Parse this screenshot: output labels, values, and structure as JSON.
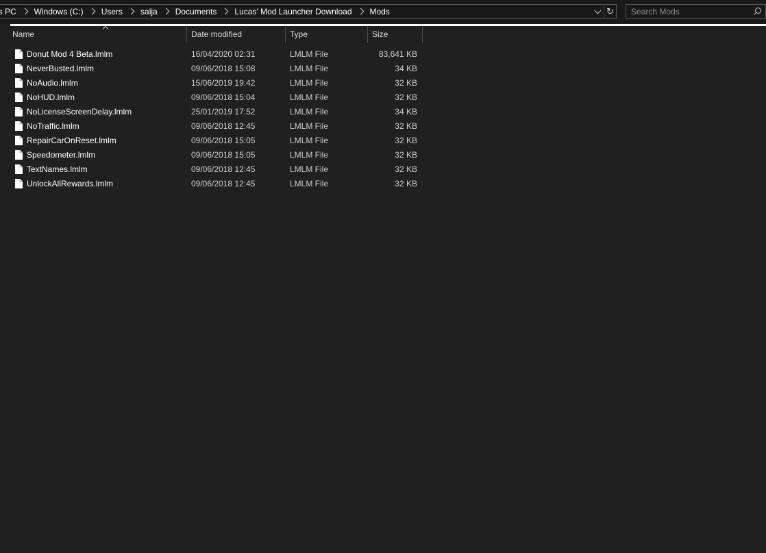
{
  "address": {
    "crumbs": [
      "is PC",
      "Windows (C:)",
      "Users",
      "salja",
      "Documents",
      "Lucas' Mod Launcher Download",
      "Mods"
    ]
  },
  "search": {
    "placeholder": "Search Mods"
  },
  "columns": {
    "name": "Name",
    "date": "Date modified",
    "type": "Type",
    "size": "Size"
  },
  "files": [
    {
      "name": "Donut Mod 4 Beta.lmlm",
      "date": "16/04/2020 02:31",
      "type": "LMLM File",
      "size": "83,641 KB"
    },
    {
      "name": "NeverBusted.lmlm",
      "date": "09/06/2018 15:08",
      "type": "LMLM File",
      "size": "34 KB"
    },
    {
      "name": "NoAudio.lmlm",
      "date": "15/06/2019 19:42",
      "type": "LMLM File",
      "size": "32 KB"
    },
    {
      "name": "NoHUD.lmlm",
      "date": "09/06/2018 15:04",
      "type": "LMLM File",
      "size": "32 KB"
    },
    {
      "name": "NoLicenseScreenDelay.lmlm",
      "date": "25/01/2019 17:52",
      "type": "LMLM File",
      "size": "34 KB"
    },
    {
      "name": "NoTraffic.lmlm",
      "date": "09/06/2018 12:45",
      "type": "LMLM File",
      "size": "32 KB"
    },
    {
      "name": "RepairCarOnReset.lmlm",
      "date": "09/06/2018 15:05",
      "type": "LMLM File",
      "size": "32 KB"
    },
    {
      "name": "Speedometer.lmlm",
      "date": "09/06/2018 15:05",
      "type": "LMLM File",
      "size": "32 KB"
    },
    {
      "name": "TextNames.lmlm",
      "date": "09/06/2018 12:45",
      "type": "LMLM File",
      "size": "32 KB"
    },
    {
      "name": "UnlockAllRewards.lmlm",
      "date": "09/06/2018 12:45",
      "type": "LMLM File",
      "size": "32 KB"
    }
  ],
  "icons": {
    "file": "file-icon",
    "search": "search-icon",
    "refresh": "refresh-icon",
    "dropdown": "chevron-down-icon",
    "sort": "sort-up-icon"
  },
  "colors": {
    "background": "#202020",
    "toolbar": "#191919",
    "text": "#ffffff",
    "secondary_text": "#cfcfcf"
  }
}
